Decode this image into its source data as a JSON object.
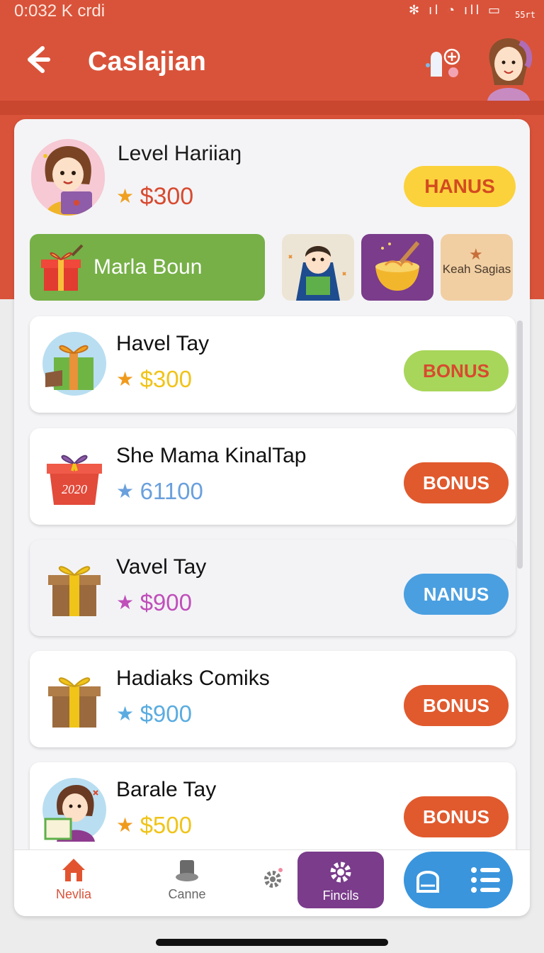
{
  "status_bar": {
    "time": "0:032 K  crdi",
    "icons": "✻ ıl ◔ ıll ▭",
    "extra": "55rt"
  },
  "header": {
    "title": "Caslajian",
    "back_icon": "arrow-left-icon"
  },
  "level_card": {
    "title": "Level Hariiaŋ",
    "amount": "$300",
    "button_label": "HANUS"
  },
  "banner": {
    "label": "Marla Boun"
  },
  "tiles": [
    {
      "name": "reader-kid"
    },
    {
      "name": "noodle-bowl"
    },
    {
      "label": "Keah Sagias"
    }
  ],
  "items": [
    {
      "title": "Havel Tay",
      "amount": "$300",
      "button": "BONUS",
      "amount_color": "#f0c419",
      "star_color": "#f09a1c",
      "button_bg": "#a8d65a",
      "button_fg": "#d84a2f"
    },
    {
      "title": "She Mama KinalTap",
      "amount": "61100",
      "button": "BONUS",
      "amount_color": "#6aa0dc",
      "star_color": "#6aa0dc",
      "button_bg": "#e05a2e",
      "button_fg": "#ffffff",
      "icon_label": "2020"
    },
    {
      "title": "Vavel Tay",
      "amount": "$900",
      "button": "NANUS",
      "amount_color": "#c04fba",
      "star_color": "#c04fba",
      "button_bg": "#4a9fe0",
      "button_fg": "#ffffff"
    },
    {
      "title": "Hadiaks Comiks",
      "amount": "$900",
      "button": "BONUS",
      "amount_color": "#5aace0",
      "star_color": "#5aace0",
      "button_bg": "#e05a2e",
      "button_fg": "#ffffff"
    },
    {
      "title": "Barale Tay",
      "amount": "$500",
      "button": "BONUS",
      "amount_color": "#f0c419",
      "star_color": "#f09a1c",
      "button_bg": "#e05a2e",
      "button_fg": "#ffffff"
    }
  ],
  "bottom_nav": {
    "home": "Nevlia",
    "game": "Canne",
    "active": "Fincils"
  },
  "colors": {
    "brand": "#d9533a",
    "purple": "#7a3c8b",
    "blue": "#3a95dc"
  }
}
